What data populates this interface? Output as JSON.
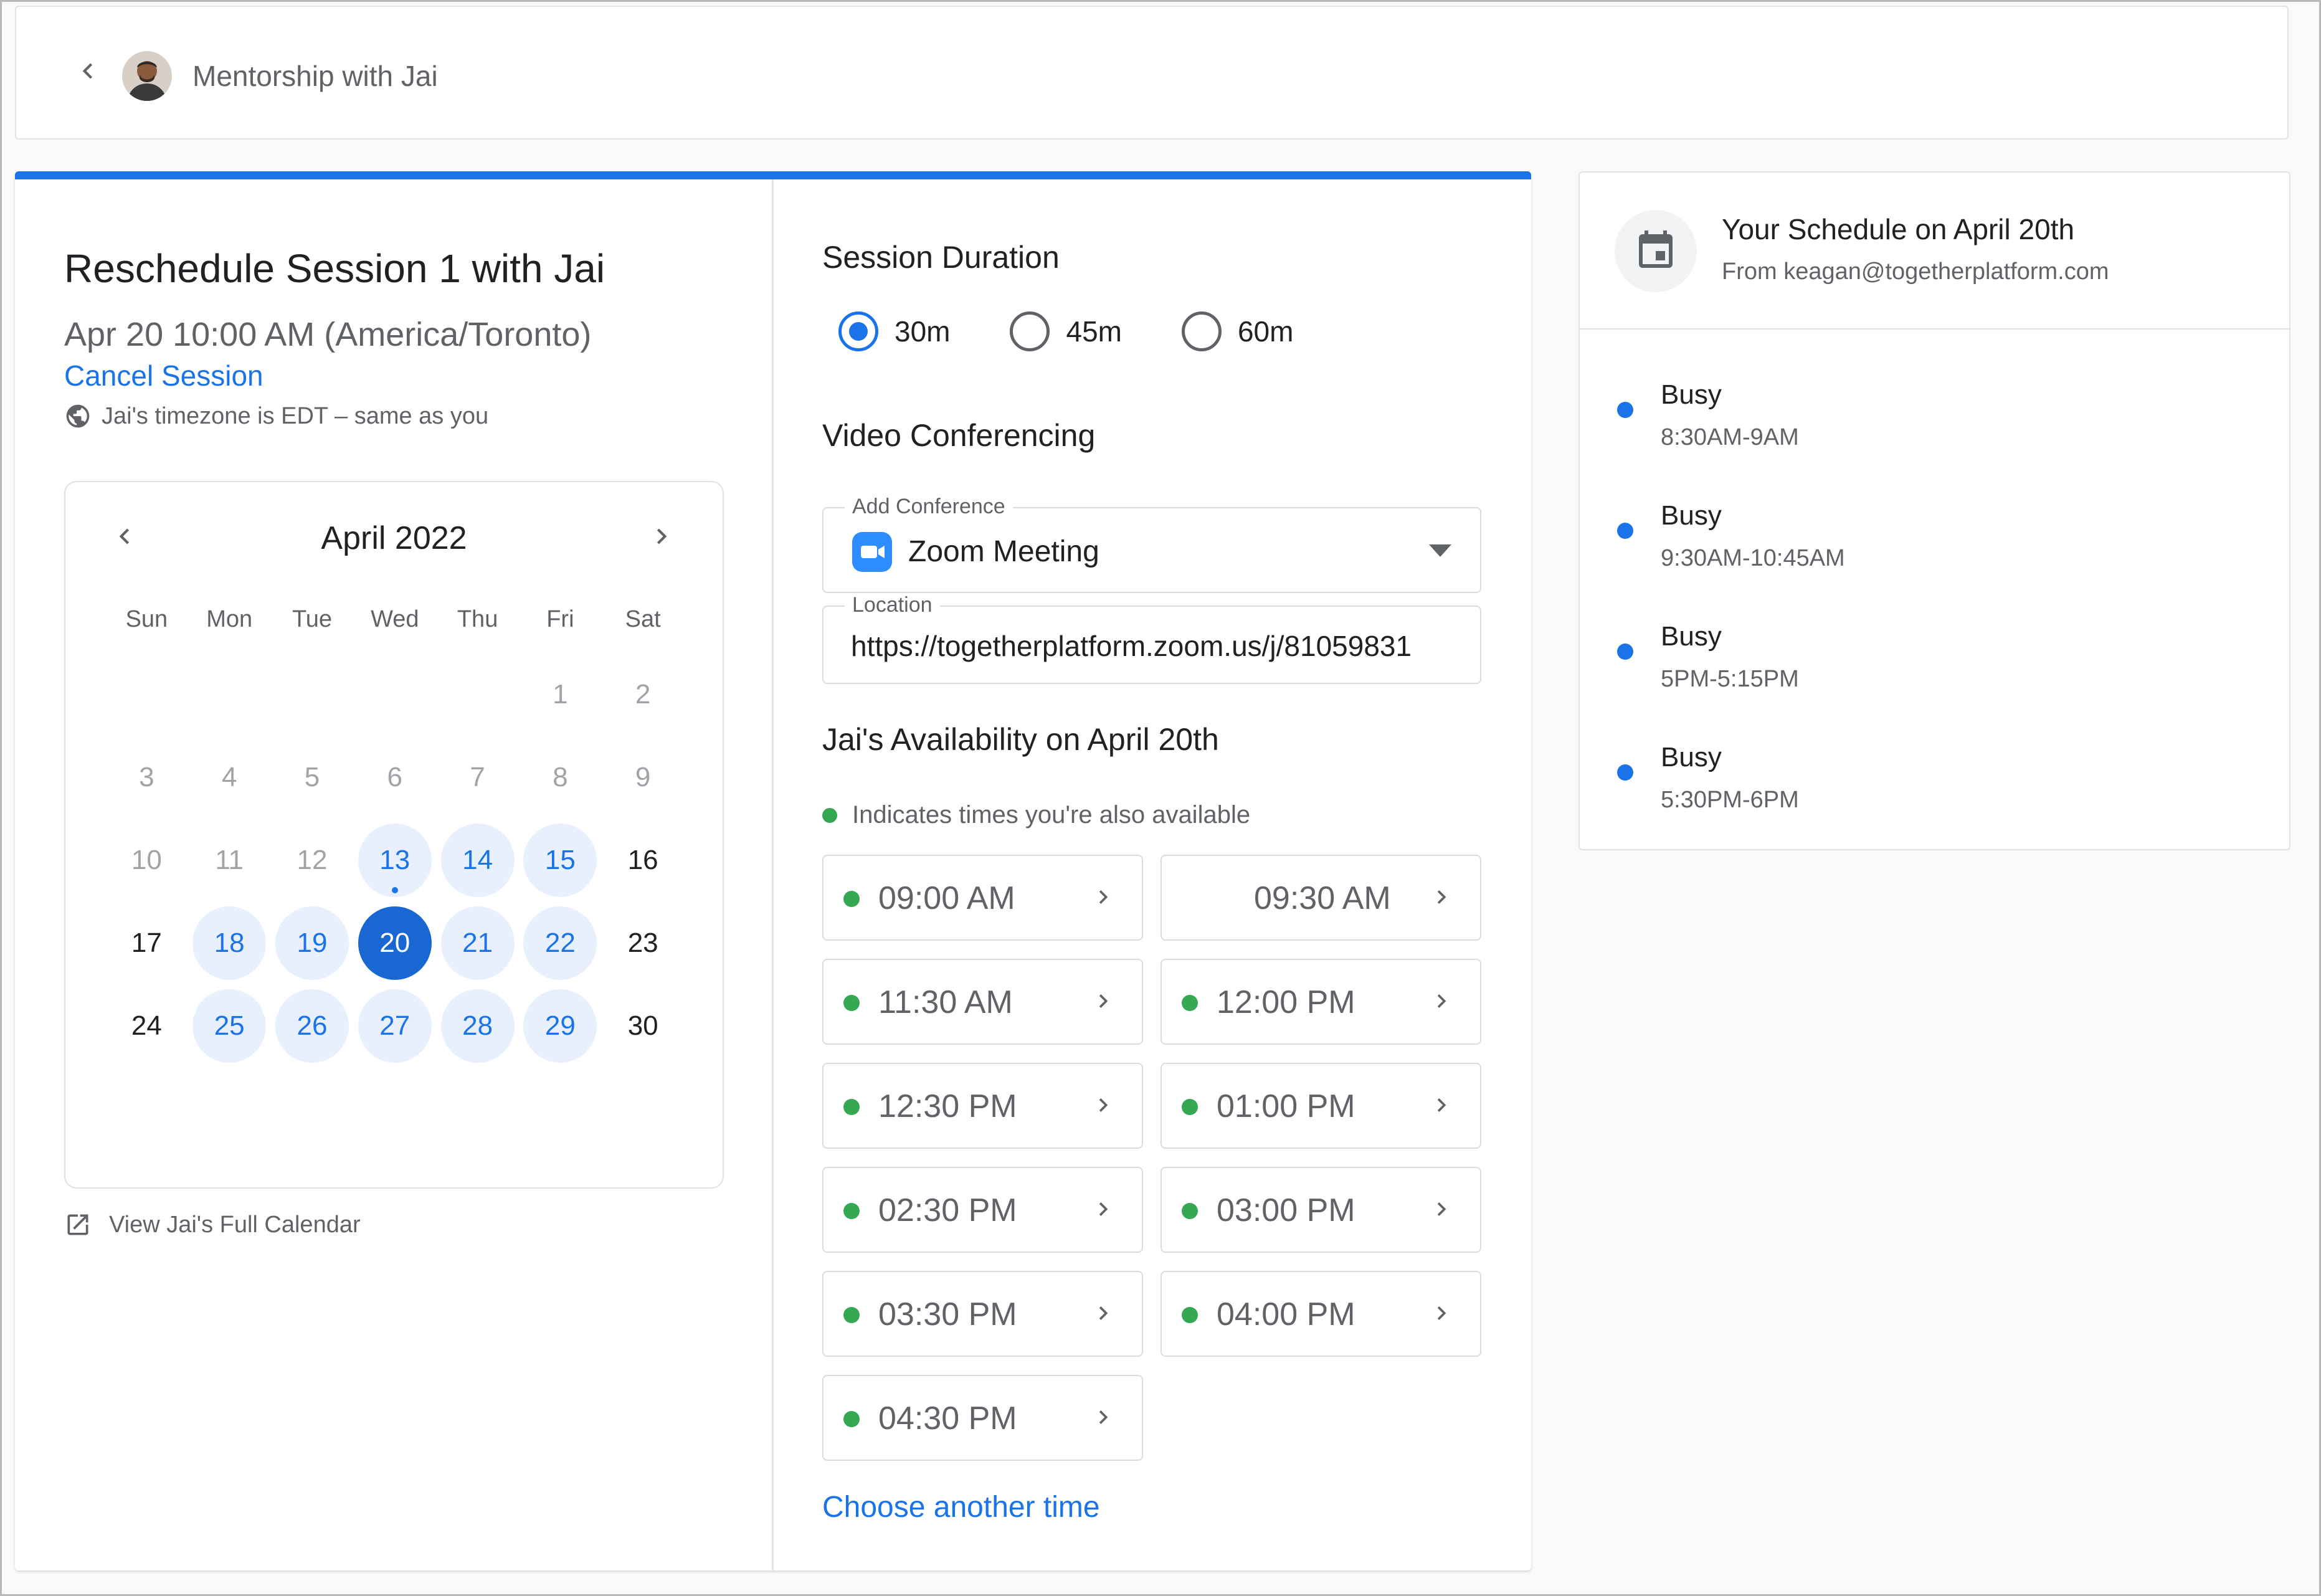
{
  "header": {
    "title": "Mentorship with Jai",
    "avatar_icon": "user-avatar"
  },
  "session": {
    "title": "Reschedule Session 1 with Jai",
    "datetime": "Apr 20 10:00 AM (America/Toronto)",
    "cancel_label": "Cancel Session",
    "timezone_note": "Jai's timezone is EDT – same as you"
  },
  "calendar": {
    "month_label": "April 2022",
    "weekdays": [
      "Sun",
      "Mon",
      "Tue",
      "Wed",
      "Thu",
      "Fri",
      "Sat"
    ],
    "weeks": [
      [
        {
          "d": "",
          "s": "empty"
        },
        {
          "d": "",
          "s": "empty"
        },
        {
          "d": "",
          "s": "empty"
        },
        {
          "d": "",
          "s": "empty"
        },
        {
          "d": "",
          "s": "empty"
        },
        {
          "d": "1",
          "s": "muted"
        },
        {
          "d": "2",
          "s": "muted"
        }
      ],
      [
        {
          "d": "3",
          "s": "muted"
        },
        {
          "d": "4",
          "s": "muted"
        },
        {
          "d": "5",
          "s": "muted"
        },
        {
          "d": "6",
          "s": "muted"
        },
        {
          "d": "7",
          "s": "muted"
        },
        {
          "d": "8",
          "s": "muted"
        },
        {
          "d": "9",
          "s": "muted"
        }
      ],
      [
        {
          "d": "10",
          "s": "muted"
        },
        {
          "d": "11",
          "s": "muted"
        },
        {
          "d": "12",
          "s": "muted"
        },
        {
          "d": "13",
          "s": "avail",
          "today": true
        },
        {
          "d": "14",
          "s": "avail"
        },
        {
          "d": "15",
          "s": "avail"
        },
        {
          "d": "16",
          "s": "normal"
        }
      ],
      [
        {
          "d": "17",
          "s": "normal"
        },
        {
          "d": "18",
          "s": "avail"
        },
        {
          "d": "19",
          "s": "avail"
        },
        {
          "d": "20",
          "s": "selected"
        },
        {
          "d": "21",
          "s": "avail"
        },
        {
          "d": "22",
          "s": "avail"
        },
        {
          "d": "23",
          "s": "normal"
        }
      ],
      [
        {
          "d": "24",
          "s": "normal"
        },
        {
          "d": "25",
          "s": "avail"
        },
        {
          "d": "26",
          "s": "avail"
        },
        {
          "d": "27",
          "s": "avail"
        },
        {
          "d": "28",
          "s": "avail"
        },
        {
          "d": "29",
          "s": "avail"
        },
        {
          "d": "30",
          "s": "normal"
        }
      ]
    ],
    "view_full_label": "View Jai's Full Calendar"
  },
  "duration": {
    "title": "Session Duration",
    "options": [
      {
        "label": "30m",
        "selected": true
      },
      {
        "label": "45m",
        "selected": false
      },
      {
        "label": "60m",
        "selected": false
      }
    ]
  },
  "video": {
    "title": "Video Conferencing",
    "conference_legend": "Add Conference",
    "conference_value": "Zoom Meeting",
    "location_legend": "Location",
    "location_value": "https://togetherplatform.zoom.us/j/81059831"
  },
  "availability": {
    "title": "Jai's Availability on April 20th",
    "legend": "Indicates times you're also available",
    "slots": [
      {
        "time": "09:00 AM",
        "mutual": true
      },
      {
        "time": "09:30 AM",
        "mutual": false
      },
      {
        "time": "11:30 AM",
        "mutual": true
      },
      {
        "time": "12:00 PM",
        "mutual": true
      },
      {
        "time": "12:30 PM",
        "mutual": true
      },
      {
        "time": "01:00 PM",
        "mutual": true
      },
      {
        "time": "02:30 PM",
        "mutual": true
      },
      {
        "time": "03:00 PM",
        "mutual": true
      },
      {
        "time": "03:30 PM",
        "mutual": true
      },
      {
        "time": "04:00 PM",
        "mutual": true
      },
      {
        "time": "04:30 PM",
        "mutual": true
      }
    ],
    "choose_another": "Choose another time"
  },
  "schedule": {
    "title": "Your Schedule on April 20th",
    "from": "From keagan@togetherplatform.com",
    "events": [
      {
        "status": "Busy",
        "time": "8:30AM-9AM"
      },
      {
        "status": "Busy",
        "time": "9:30AM-10:45AM"
      },
      {
        "status": "Busy",
        "time": "5PM-5:15PM"
      },
      {
        "status": "Busy",
        "time": "5:30PM-6PM"
      }
    ]
  },
  "colors": {
    "accent": "#1a73e8",
    "selected_day": "#1967d2",
    "available_day_bg": "#e8f0fe",
    "mutual_dot": "#34a853",
    "zoom": "#2d8cff"
  }
}
